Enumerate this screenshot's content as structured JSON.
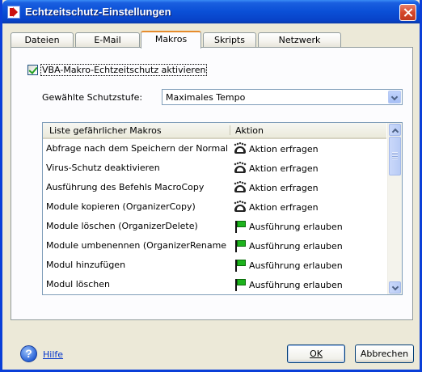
{
  "window": {
    "title": "Echtzeitschutz-Einstellungen"
  },
  "tabs": [
    {
      "label": "Dateien",
      "active": false
    },
    {
      "label": "E-Mail",
      "active": false
    },
    {
      "label": "Makros",
      "active": true
    },
    {
      "label": "Skripts",
      "active": false
    },
    {
      "label": "Netzwerk",
      "active": false
    }
  ],
  "macros": {
    "enable_checkbox": {
      "label": "VBA-Makro-Echtzeitschutz aktivieren",
      "checked": true
    },
    "level": {
      "label": "Gewählte Schutzstufe:",
      "value": "Maximales Tempo"
    },
    "list": {
      "col_name": "Liste gefährlicher Makros",
      "col_action": "Aktion",
      "rows": [
        {
          "name": "Abfrage nach dem Speichern der Normal-Vorl...",
          "action": "Aktion erfragen",
          "icon": "ask-icon"
        },
        {
          "name": "Virus-Schutz deaktivieren",
          "action": "Aktion erfragen",
          "icon": "ask-icon"
        },
        {
          "name": "Ausführung des Befehls MacroCopy",
          "action": "Aktion erfragen",
          "icon": "ask-icon"
        },
        {
          "name": "Module kopieren (OrganizerCopy)",
          "action": "Aktion erfragen",
          "icon": "ask-icon"
        },
        {
          "name": "Module löschen (OrganizerDelete)",
          "action": "Ausführung erlauben",
          "icon": "allow-flag-icon"
        },
        {
          "name": "Module umbenennen (OrganizerRename)",
          "action": "Ausführung erlauben",
          "icon": "allow-flag-icon"
        },
        {
          "name": "Modul hinzufügen",
          "action": "Ausführung erlauben",
          "icon": "allow-flag-icon"
        },
        {
          "name": "Modul löschen",
          "action": "Ausführung erlauben",
          "icon": "allow-flag-icon"
        }
      ]
    }
  },
  "footer": {
    "help": "Hilfe",
    "ok": "OK",
    "cancel": "Abbrechen"
  }
}
